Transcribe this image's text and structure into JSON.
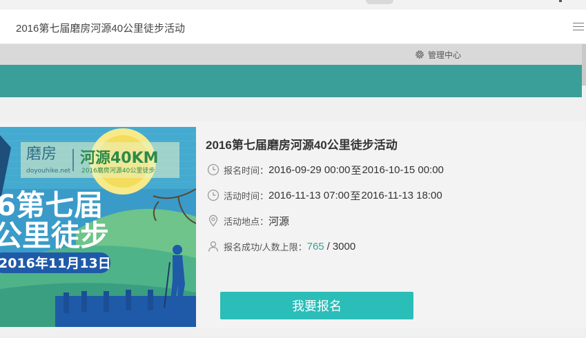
{
  "page": {
    "title": "2016第七届磨房河源40公里徒步活动"
  },
  "admin": {
    "label": "管理中心"
  },
  "event": {
    "title": "2016第七届磨房河源40公里徒步活动",
    "signup_time": {
      "label": "报名时间：",
      "start": "2016-09-29 00:00",
      "separator": "至",
      "end": "2016-10-15 00:00"
    },
    "activity_time": {
      "label": "活动时间：",
      "start": "2016-11-13 07:00",
      "separator": "至",
      "end": "2016-11-13 18:00"
    },
    "location": {
      "label": "活动地点：",
      "value": "河源"
    },
    "capacity": {
      "label": "报名成功/人数上限：",
      "registered": "765",
      "divider": "/",
      "limit": "3000"
    },
    "signup_button": "我要报名"
  },
  "poster": {
    "brand": "磨房",
    "brand_url": "doyouhike.net",
    "headline": "河源40KM",
    "subheadline": "2016磨房河源40公里徒步",
    "line1": "6第七届",
    "line2": "公里徒步",
    "date": "2016年11月13日"
  },
  "colors": {
    "teal": "#3a9e99",
    "button": "#2bbdb8"
  }
}
